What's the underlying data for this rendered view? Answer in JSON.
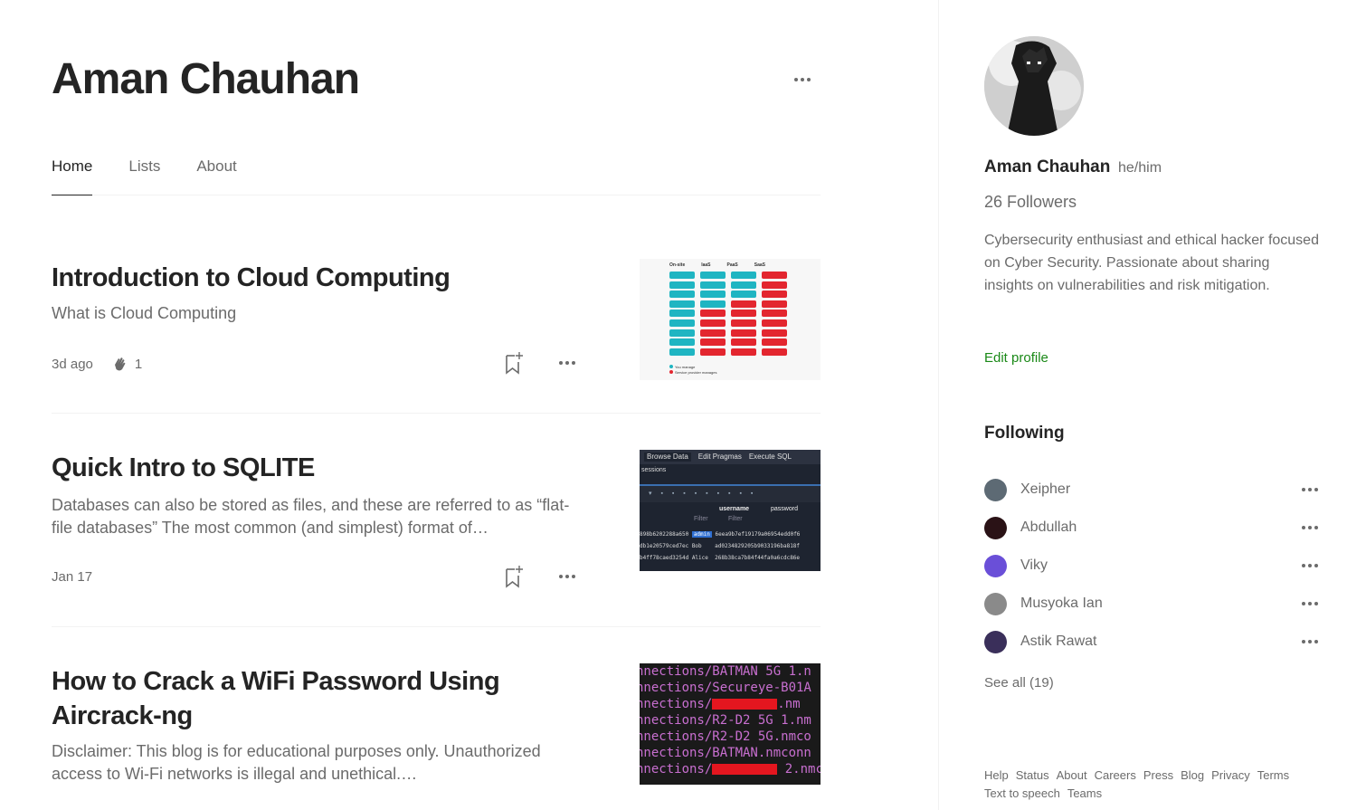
{
  "profile": {
    "name": "Aman Chauhan"
  },
  "tabs": [
    "Home",
    "Lists",
    "About"
  ],
  "articles": [
    {
      "title": "Introduction to Cloud Computing",
      "subtitle": "What is Cloud Computing",
      "date": "3d ago",
      "claps": "1",
      "thumb": {
        "headers": [
          "On-site",
          "IaaS",
          "PaaS",
          "SaaS"
        ],
        "legend": [
          "You manage",
          "Service provider manages"
        ]
      }
    },
    {
      "title": "Quick Intro to SQLITE",
      "subtitle": "Databases can also be stored as files, and these are referred to as “flat-file databases” The most common (and simplest) format of…",
      "date": "Jan 17",
      "thumb": {
        "tabs": [
          "Browse Data",
          "Edit Pragmas",
          "Execute SQL"
        ],
        "label": "sessions",
        "columns": [
          "username",
          "password"
        ],
        "filter": [
          "Filter",
          "Filter"
        ],
        "rows": [
          {
            "id": "898b6202288a650",
            "user": "admin",
            "pass": "6eea9b7ef19179a06954edd0f6"
          },
          {
            "id": "db1e20579ced7ec",
            "user": "Bob",
            "pass": "ad0234829205b9033196ba818f"
          },
          {
            "id": "b4ff78caed3254d",
            "user": "Alice",
            "pass": "268b38ca7b84f44fa0a6cdc86e"
          }
        ]
      }
    },
    {
      "title": "How to Crack a WiFi Password Using Aircrack-ng",
      "subtitle": "Disclaimer: This blog is for educational purposes only. Unauthorized access to Wi-Fi networks is illegal and unethical.…",
      "thumb": {
        "lines": [
          {
            "pre": "nnections/BATMAN 5G 1.n",
            "post": ""
          },
          {
            "pre": "nnections/Secureye-B01A",
            "post": ""
          },
          {
            "pre": "nnections/",
            "post": ".nm"
          },
          {
            "pre": "nnections/R2-D2 5G 1.nm",
            "post": ""
          },
          {
            "pre": "nnections/R2-D2 5G.nmco",
            "post": ""
          },
          {
            "pre": "nnections/BATMAN.nmconn",
            "post": ""
          },
          {
            "pre": "nnections/",
            "post": " 2.nmc"
          }
        ],
        "redacted": [
          2,
          6
        ]
      }
    }
  ],
  "sidebar": {
    "name": "Aman Chauhan",
    "pronoun": "he/him",
    "followers": "26 Followers",
    "bio": "Cybersecurity enthusiast and ethical hacker focused on Cyber Security. Passionate about sharing insights on vulnerabilities and risk mitigation.",
    "edit_profile": "Edit profile",
    "following_title": "Following",
    "following": [
      {
        "name": "Xeipher",
        "color": "#5d6a74"
      },
      {
        "name": "Abdullah",
        "color": "#2a1216"
      },
      {
        "name": "Viky",
        "color": "#6a4fd8"
      },
      {
        "name": "Musyoka Ian",
        "color": "#8a8a8a"
      },
      {
        "name": "Astik Rawat",
        "color": "#3a2f5a"
      }
    ],
    "see_all": "See all (19)",
    "footer": [
      "Help",
      "Status",
      "About",
      "Careers",
      "Press",
      "Blog",
      "Privacy",
      "Terms",
      "Text to speech",
      "Teams"
    ]
  },
  "colors": {
    "accent_green": "#1a8917",
    "text": "#242424",
    "muted": "#6b6b6b"
  }
}
